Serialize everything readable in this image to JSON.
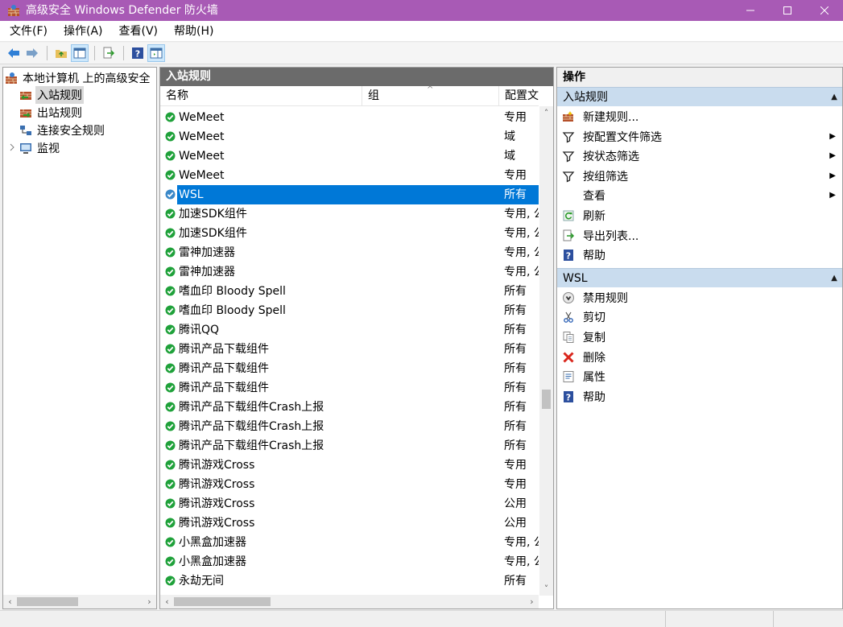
{
  "window": {
    "title": "高级安全 Windows Defender 防火墙",
    "controls": {
      "minimize": "—",
      "maximize": "☐",
      "close": "✕"
    }
  },
  "menubar": {
    "items": [
      "文件(F)",
      "操作(A)",
      "查看(V)",
      "帮助(H)"
    ]
  },
  "tree": {
    "items": [
      {
        "label": "本地计算机 上的高级安全",
        "icon": "firewall-icon",
        "indent": 0
      },
      {
        "label": "入站规则",
        "icon": "inbound-rules-icon",
        "indent": 1,
        "selected": true
      },
      {
        "label": "出站规则",
        "icon": "outbound-rules-icon",
        "indent": 1
      },
      {
        "label": "连接安全规则",
        "icon": "connection-security-icon",
        "indent": 1
      },
      {
        "label": "监视",
        "icon": "monitor-icon",
        "indent": 1,
        "expandable": true
      }
    ],
    "scroll": {
      "left_arrow": "‹",
      "right_arrow": "›"
    }
  },
  "list": {
    "header": "入站规则",
    "columns": {
      "name": "名称",
      "group": "组",
      "profile": "配置文",
      "sort_arrow": "^"
    },
    "rows": [
      {
        "name": "WeMeet",
        "group": "",
        "profile": "专用"
      },
      {
        "name": "WeMeet",
        "group": "",
        "profile": "域"
      },
      {
        "name": "WeMeet",
        "group": "",
        "profile": "域"
      },
      {
        "name": "WeMeet",
        "group": "",
        "profile": "专用"
      },
      {
        "name": "WSL",
        "group": "",
        "profile": "所有",
        "selected": true
      },
      {
        "name": "加速SDK组件",
        "group": "",
        "profile": "专用, 公"
      },
      {
        "name": "加速SDK组件",
        "group": "",
        "profile": "专用, 公"
      },
      {
        "name": "雷神加速器",
        "group": "",
        "profile": "专用, 公"
      },
      {
        "name": "雷神加速器",
        "group": "",
        "profile": "专用, 公"
      },
      {
        "name": "嗜血印 Bloody Spell",
        "group": "",
        "profile": "所有"
      },
      {
        "name": "嗜血印 Bloody Spell",
        "group": "",
        "profile": "所有"
      },
      {
        "name": "腾讯QQ",
        "group": "",
        "profile": "所有"
      },
      {
        "name": "腾讯产品下载组件",
        "group": "",
        "profile": "所有"
      },
      {
        "name": "腾讯产品下载组件",
        "group": "",
        "profile": "所有"
      },
      {
        "name": "腾讯产品下载组件",
        "group": "",
        "profile": "所有"
      },
      {
        "name": "腾讯产品下载组件Crash上报",
        "group": "",
        "profile": "所有"
      },
      {
        "name": "腾讯产品下载组件Crash上报",
        "group": "",
        "profile": "所有"
      },
      {
        "name": "腾讯产品下载组件Crash上报",
        "group": "",
        "profile": "所有"
      },
      {
        "name": "腾讯游戏Cross",
        "group": "",
        "profile": "专用"
      },
      {
        "name": "腾讯游戏Cross",
        "group": "",
        "profile": "专用"
      },
      {
        "name": "腾讯游戏Cross",
        "group": "",
        "profile": "公用"
      },
      {
        "name": "腾讯游戏Cross",
        "group": "",
        "profile": "公用"
      },
      {
        "name": "小黑盒加速器",
        "group": "",
        "profile": "专用, 公"
      },
      {
        "name": "小黑盒加速器",
        "group": "",
        "profile": "专用, 公"
      },
      {
        "name": "永劫无间",
        "group": "",
        "profile": "所有"
      }
    ],
    "scroll": {
      "up_arrow": "˄",
      "down_arrow": "˅",
      "left_arrow": "‹",
      "right_arrow": "›"
    }
  },
  "actions": {
    "header": "操作",
    "sections": [
      {
        "title": "入站规则",
        "items": [
          {
            "label": "新建规则...",
            "icon": "new-rule-icon"
          },
          {
            "label": "按配置文件筛选",
            "icon": "filter-icon",
            "submenu": true
          },
          {
            "label": "按状态筛选",
            "icon": "filter-icon",
            "submenu": true
          },
          {
            "label": "按组筛选",
            "icon": "filter-icon",
            "submenu": true
          },
          {
            "label": "查看",
            "icon": "",
            "submenu": true
          },
          {
            "label": "刷新",
            "icon": "refresh-icon"
          },
          {
            "label": "导出列表...",
            "icon": "export-icon"
          },
          {
            "label": "帮助",
            "icon": "help-icon"
          }
        ]
      },
      {
        "title": "WSL",
        "items": [
          {
            "label": "禁用规则",
            "icon": "disable-rule-icon"
          },
          {
            "label": "剪切",
            "icon": "cut-icon"
          },
          {
            "label": "复制",
            "icon": "copy-icon"
          },
          {
            "label": "删除",
            "icon": "delete-icon"
          },
          {
            "label": "属性",
            "icon": "properties-icon"
          },
          {
            "label": "帮助",
            "icon": "help-icon"
          }
        ]
      }
    ],
    "collapse_glyph": "▲",
    "submenu_glyph": "▶"
  },
  "colors": {
    "titlebar": "#a85ab5",
    "selection": "#0078d7",
    "enabled_rule": "#1fa13a",
    "section_header": "#c9dcee",
    "pane_header": "#6b6b6b"
  }
}
